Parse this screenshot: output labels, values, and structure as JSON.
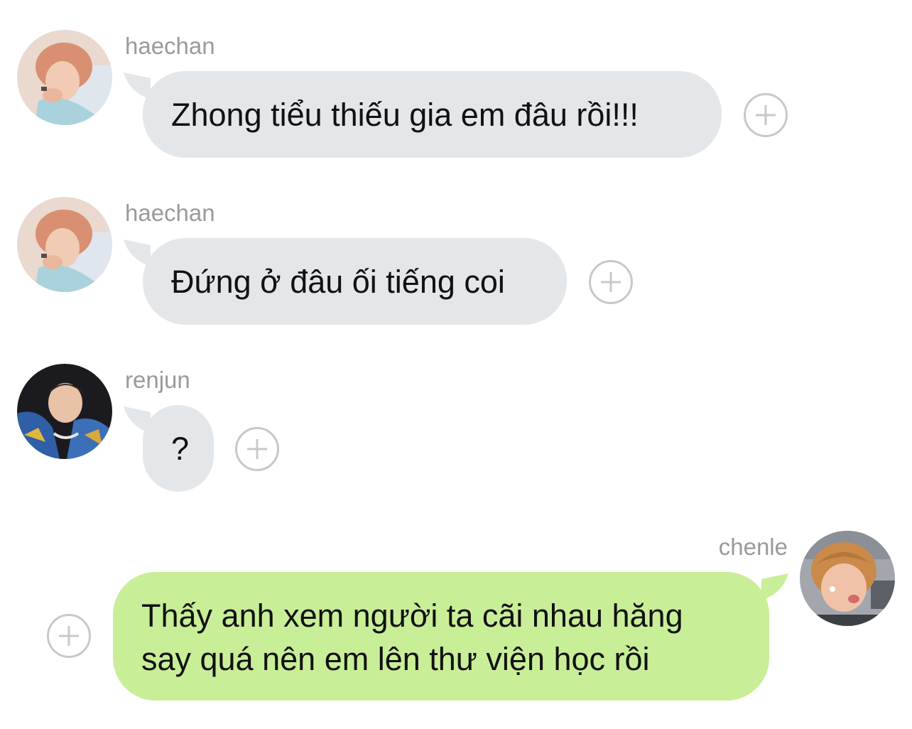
{
  "messages": [
    {
      "sender": "haechan",
      "text": "Zhong tiểu thiếu gia em đâu rồi!!!",
      "avatar_icon": "avatar-haechan"
    },
    {
      "sender": "haechan",
      "text": "Đứng ở đâu ối tiếng coi",
      "avatar_icon": "avatar-haechan"
    },
    {
      "sender": "renjun",
      "text": "?",
      "avatar_icon": "avatar-renjun"
    },
    {
      "sender": "chenle",
      "lines": [
        "Thấy anh xem người ta cãi nhau hăng",
        "say quá nên em lên thư viện học rồi"
      ],
      "avatar_icon": "avatar-chenle"
    }
  ],
  "icons": {
    "react": "plus-circle-icon"
  },
  "colors": {
    "incoming_bubble": "#e4e7ea",
    "outgoing_bubble": "#c9ee98",
    "sender_name": "#9a9a9a",
    "message_text": "#111111",
    "plus_icon": "#c8c8c8"
  }
}
